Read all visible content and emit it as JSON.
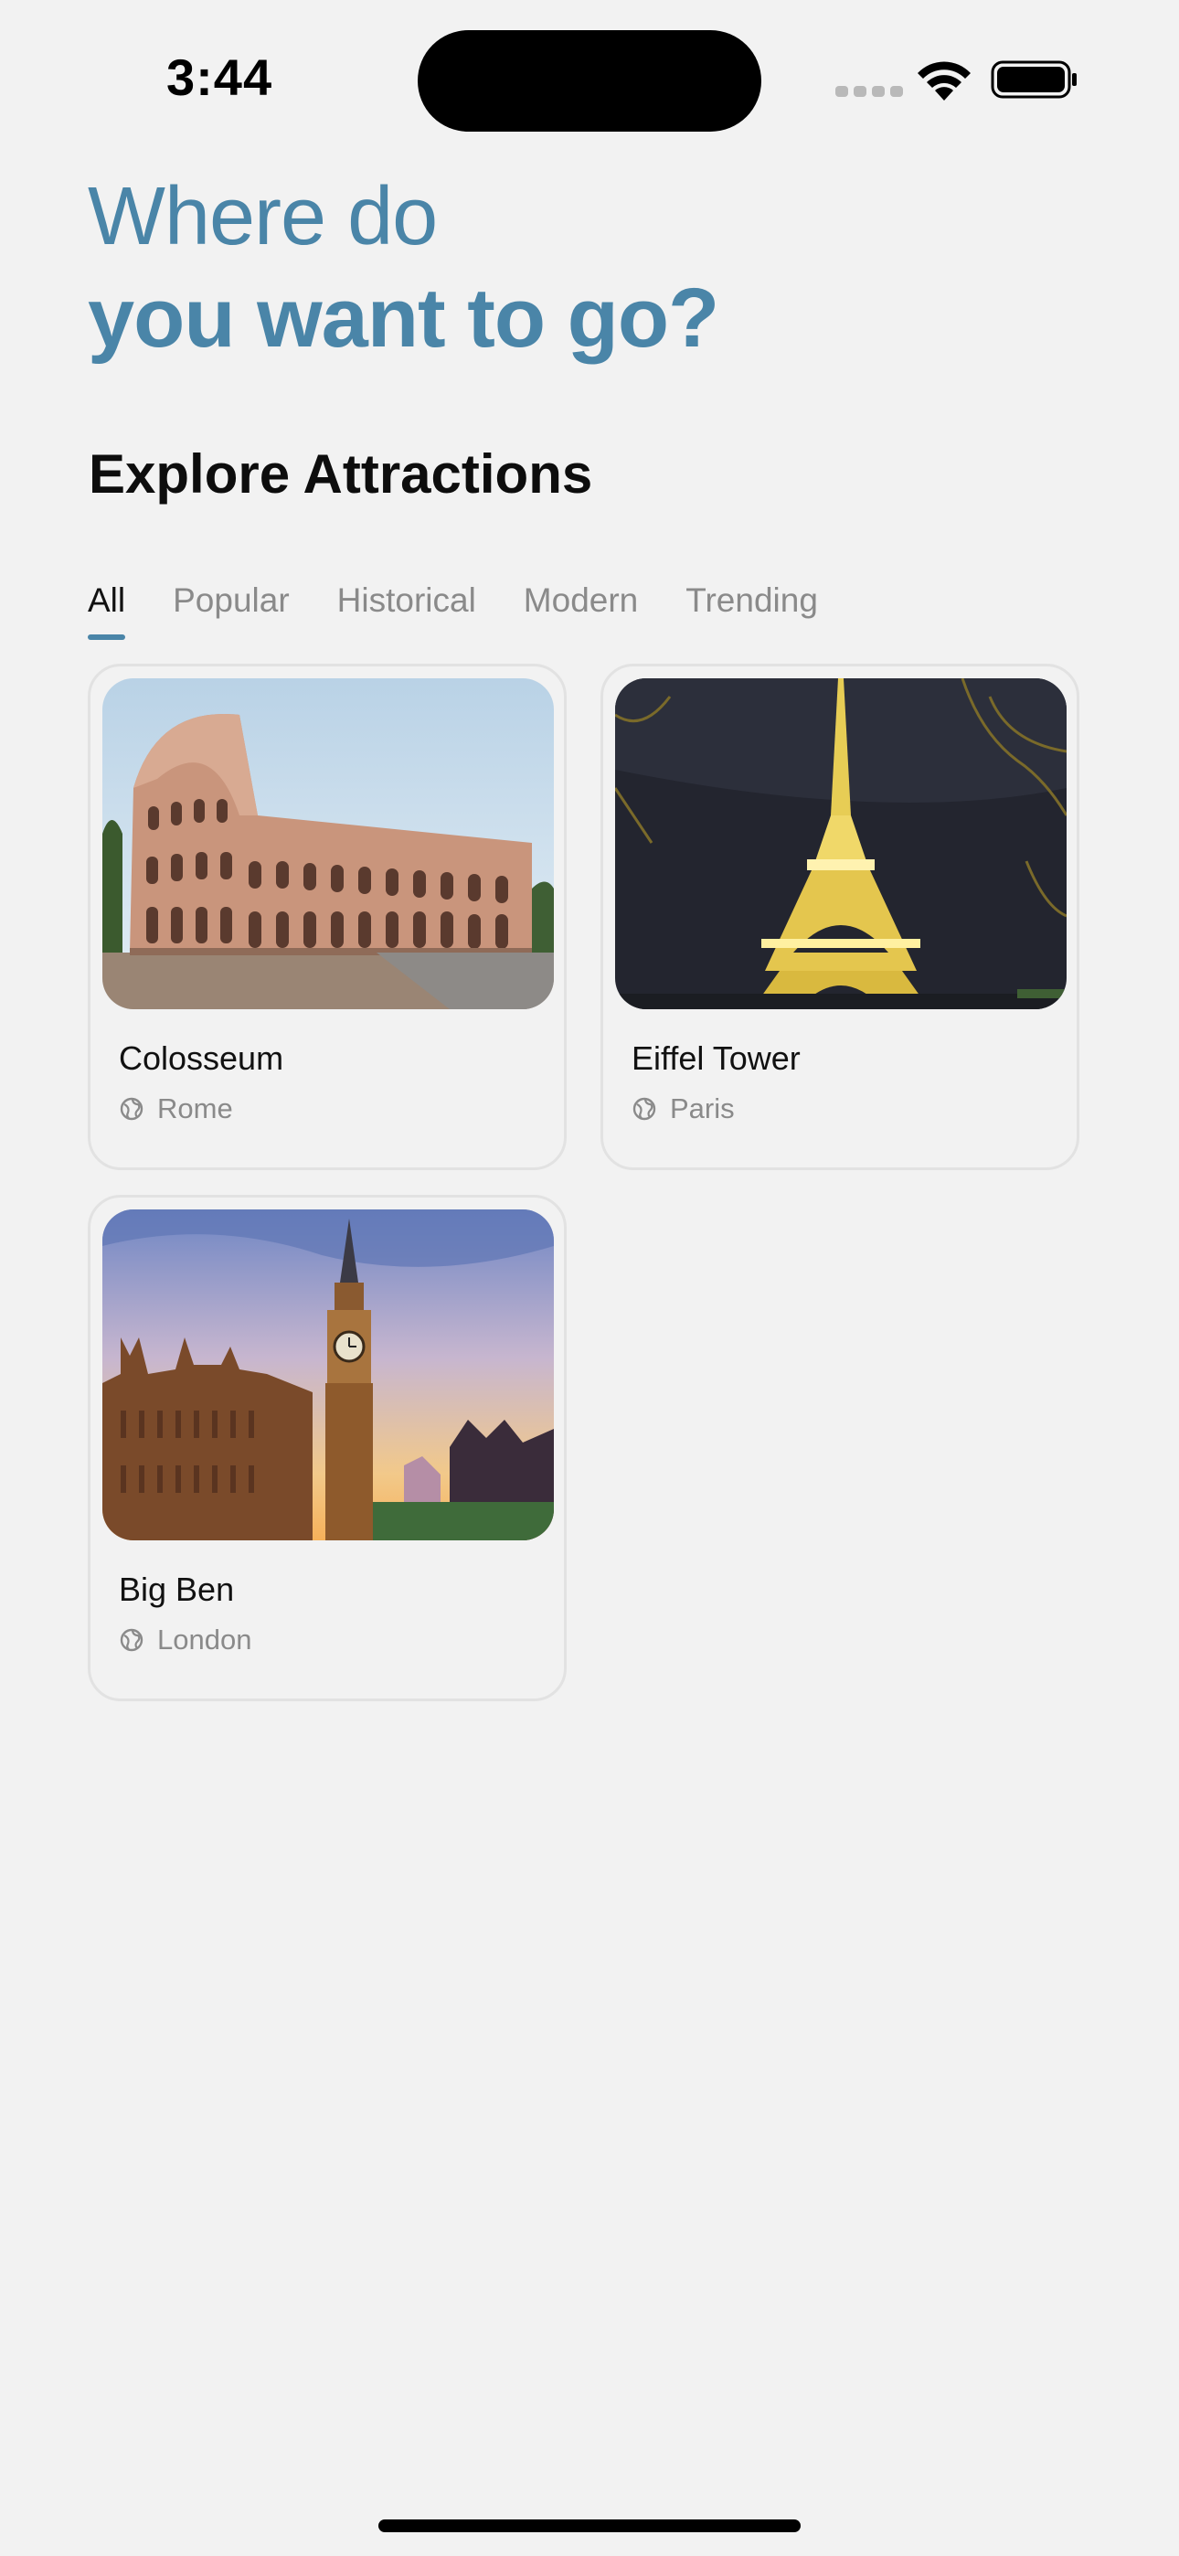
{
  "status": {
    "time": "3:44"
  },
  "header": {
    "line1": "Where do",
    "line2": "you want to go?"
  },
  "section": {
    "title": "Explore Attractions"
  },
  "tabs": [
    {
      "label": "All",
      "active": true
    },
    {
      "label": "Popular",
      "active": false
    },
    {
      "label": "Historical",
      "active": false
    },
    {
      "label": "Modern",
      "active": false
    },
    {
      "label": "Trending",
      "active": false
    }
  ],
  "attractions": [
    {
      "name": "Colosseum",
      "location": "Rome",
      "image": "colosseum"
    },
    {
      "name": "Eiffel Tower",
      "location": "Paris",
      "image": "eiffel-tower-night"
    },
    {
      "name": "Big Ben",
      "location": "London",
      "image": "big-ben-sunset"
    }
  ],
  "colors": {
    "accent": "#4a85a8",
    "background": "#f2f2f2"
  }
}
